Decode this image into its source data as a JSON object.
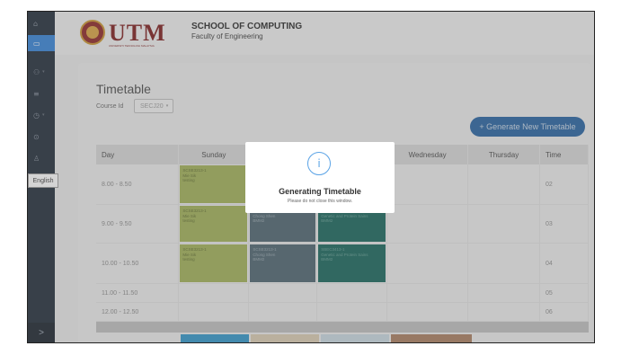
{
  "sidebar": {
    "items": [
      {
        "icon": "home-icon",
        "glyph": "⌂",
        "active": false
      },
      {
        "icon": "calendar-icon",
        "glyph": "▭",
        "active": true
      },
      {
        "icon": "users-icon",
        "glyph": "⚇",
        "active": false
      },
      {
        "icon": "list-icon",
        "glyph": "≡",
        "active": false
      },
      {
        "icon": "clock-icon",
        "glyph": "◷",
        "active": false
      },
      {
        "icon": "settings-icon",
        "glyph": "⊙",
        "active": false
      },
      {
        "icon": "user-icon",
        "glyph": "♙",
        "active": false
      }
    ],
    "language": "English",
    "collapse_glyph": ">"
  },
  "header": {
    "logo_text": "UTM",
    "logo_sub": "UNIVERSITI TEKNOLOGI MALAYSIA",
    "school": "SCHOOL OF COMPUTING",
    "faculty": "Faculty of Engineering"
  },
  "page": {
    "title": "Timetable",
    "course_label": "Course Id",
    "course_value": "SECJ20"
  },
  "generate_button": {
    "label": "+  Generate New Timetable"
  },
  "table": {
    "headers": [
      "Day",
      "Sunday",
      "",
      "",
      "Wednesday",
      "Thursday",
      "Time"
    ],
    "rows": [
      {
        "time": "8.00 - 8.50",
        "slot_no": "02",
        "slots": [
          {
            "col": 1,
            "color": "green",
            "code": "SCSE3213-1",
            "name": "Mie Sik",
            "room": "testing"
          }
        ]
      },
      {
        "time": "9.00 - 9.50",
        "slot_no": "03",
        "slots": [
          {
            "col": 1,
            "color": "green",
            "code": "SCSE3213-1",
            "name": "Mie Sik",
            "room": "testing"
          },
          {
            "col": 2,
            "color": "slate",
            "code": "SCSE3213-1",
            "name": "Chong Shen",
            "room": "BMM2"
          },
          {
            "col": 3,
            "color": "teal",
            "code": "SCSE3213-1",
            "name": "Genetic and Protein Sains",
            "room": "BMM2"
          }
        ]
      },
      {
        "time": "10.00 - 10.50",
        "slot_no": "04",
        "slots": [
          {
            "col": 1,
            "color": "green",
            "code": "SCSE3213-1",
            "name": "Mie Sik",
            "room": "testing"
          },
          {
            "col": 2,
            "color": "slate",
            "code": "SCSE3213-1",
            "name": "Chong Shen",
            "room": "BMM2"
          },
          {
            "col": 3,
            "color": "teal",
            "code": "SBEC3413-1",
            "name": "Genetic and Protein Sains",
            "room": "BMM2"
          }
        ]
      },
      {
        "time": "11.00 - 11.50",
        "slot_no": "05",
        "slots": []
      },
      {
        "time": "12.00 - 12.50",
        "slot_no": "06",
        "slots": []
      }
    ]
  },
  "modal": {
    "icon": "info-icon",
    "glyph": "i",
    "title": "Generating Timetable",
    "subtitle": "Please do not close this window."
  },
  "colors": {
    "sidebar_bg": "#1a2533",
    "active": "#2e7fd6",
    "button": "#1f5e9e",
    "slot_green": "#9eae52",
    "slot_slate": "#475f6b",
    "slot_teal": "#0f6156",
    "modal_icon": "#5aa3e6"
  }
}
